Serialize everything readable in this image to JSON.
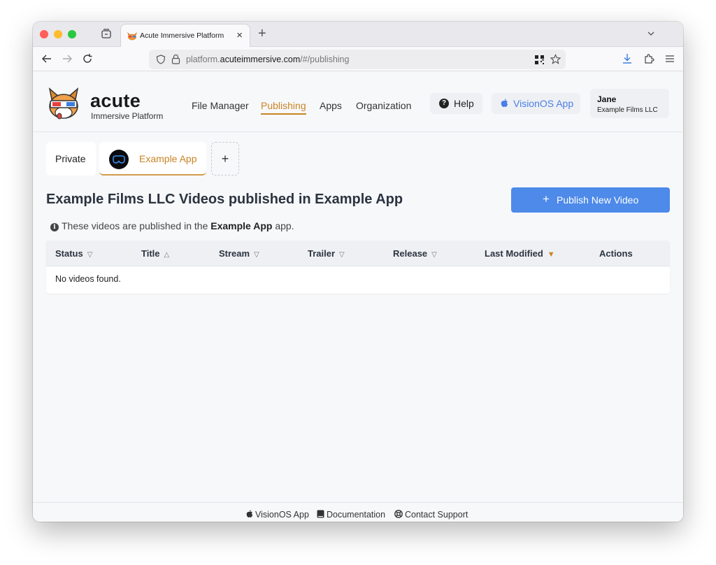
{
  "browser": {
    "tab_title": "Acute Immersive Platform",
    "url_prefix": "platform.",
    "url_domain": "acuteimmersive.com",
    "url_path": "/#/publishing"
  },
  "header": {
    "logo_word": "acute",
    "logo_sub": "Immersive Platform",
    "nav": [
      {
        "label": "File Manager",
        "active": false
      },
      {
        "label": "Publishing",
        "active": true
      },
      {
        "label": "Apps",
        "active": false
      },
      {
        "label": "Organization",
        "active": false
      }
    ],
    "help_label": "Help",
    "visionos_label": "VisionOS App",
    "user_name": "Jane",
    "user_org": "Example Films LLC"
  },
  "app_tabs": {
    "private_label": "Private",
    "app_label": "Example App",
    "add_label": "+"
  },
  "main": {
    "heading": "Example Films LLC Videos published in Example App",
    "publish_label": "Publish New Video",
    "publish_plus": "+",
    "info_prefix": "These videos are published in the",
    "info_app": "Example App",
    "info_suffix": "app."
  },
  "table": {
    "columns": [
      {
        "label": "Status",
        "sort": "▽"
      },
      {
        "label": "Title",
        "sort": "△"
      },
      {
        "label": "Stream",
        "sort": "▽"
      },
      {
        "label": "Trailer",
        "sort": "▽"
      },
      {
        "label": "Release",
        "sort": "▽"
      },
      {
        "label": "Last Modified",
        "sort": "▼"
      },
      {
        "label": "Actions",
        "sort": ""
      }
    ],
    "empty_text": "No videos found."
  },
  "footer": {
    "visionos": "VisionOS App",
    "docs": "Documentation",
    "support": "Contact Support"
  },
  "colors": {
    "accent": "#c98424",
    "primary_button": "#4d8ae9",
    "link_blue": "#4a7ee8"
  }
}
